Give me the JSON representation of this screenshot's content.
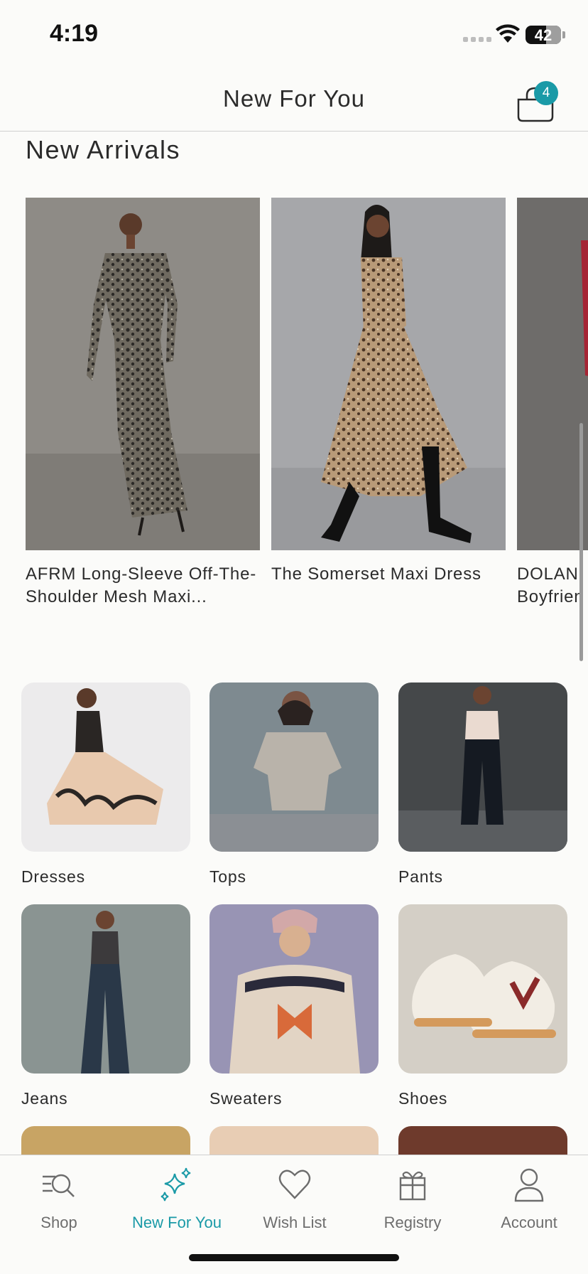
{
  "status_bar": {
    "time": "4:19",
    "battery": "42"
  },
  "header": {
    "title": "New For You",
    "cart_count": "4"
  },
  "new_arrivals": {
    "title": "New Arrivals",
    "products": [
      {
        "name": "AFRM Long-Sleeve Off-The-Shoulder Mesh Maxi..."
      },
      {
        "name": "The Somerset Maxi Dress"
      },
      {
        "name": "DOLAN Boyfrien"
      }
    ]
  },
  "categories": [
    {
      "label": "Dresses"
    },
    {
      "label": "Tops"
    },
    {
      "label": "Pants"
    },
    {
      "label": "Jeans"
    },
    {
      "label": "Sweaters"
    },
    {
      "label": "Shoes"
    }
  ],
  "tabs": [
    {
      "label": "Shop",
      "icon": "shop-search-icon"
    },
    {
      "label": "New For You",
      "icon": "sparkles-icon",
      "active": true
    },
    {
      "label": "Wish List",
      "icon": "heart-icon"
    },
    {
      "label": "Registry",
      "icon": "gift-icon"
    },
    {
      "label": "Account",
      "icon": "person-icon"
    }
  ],
  "colors": {
    "accent": "#1a9aa7",
    "background": "#fbfbf9",
    "text": "#2b2b2b"
  }
}
